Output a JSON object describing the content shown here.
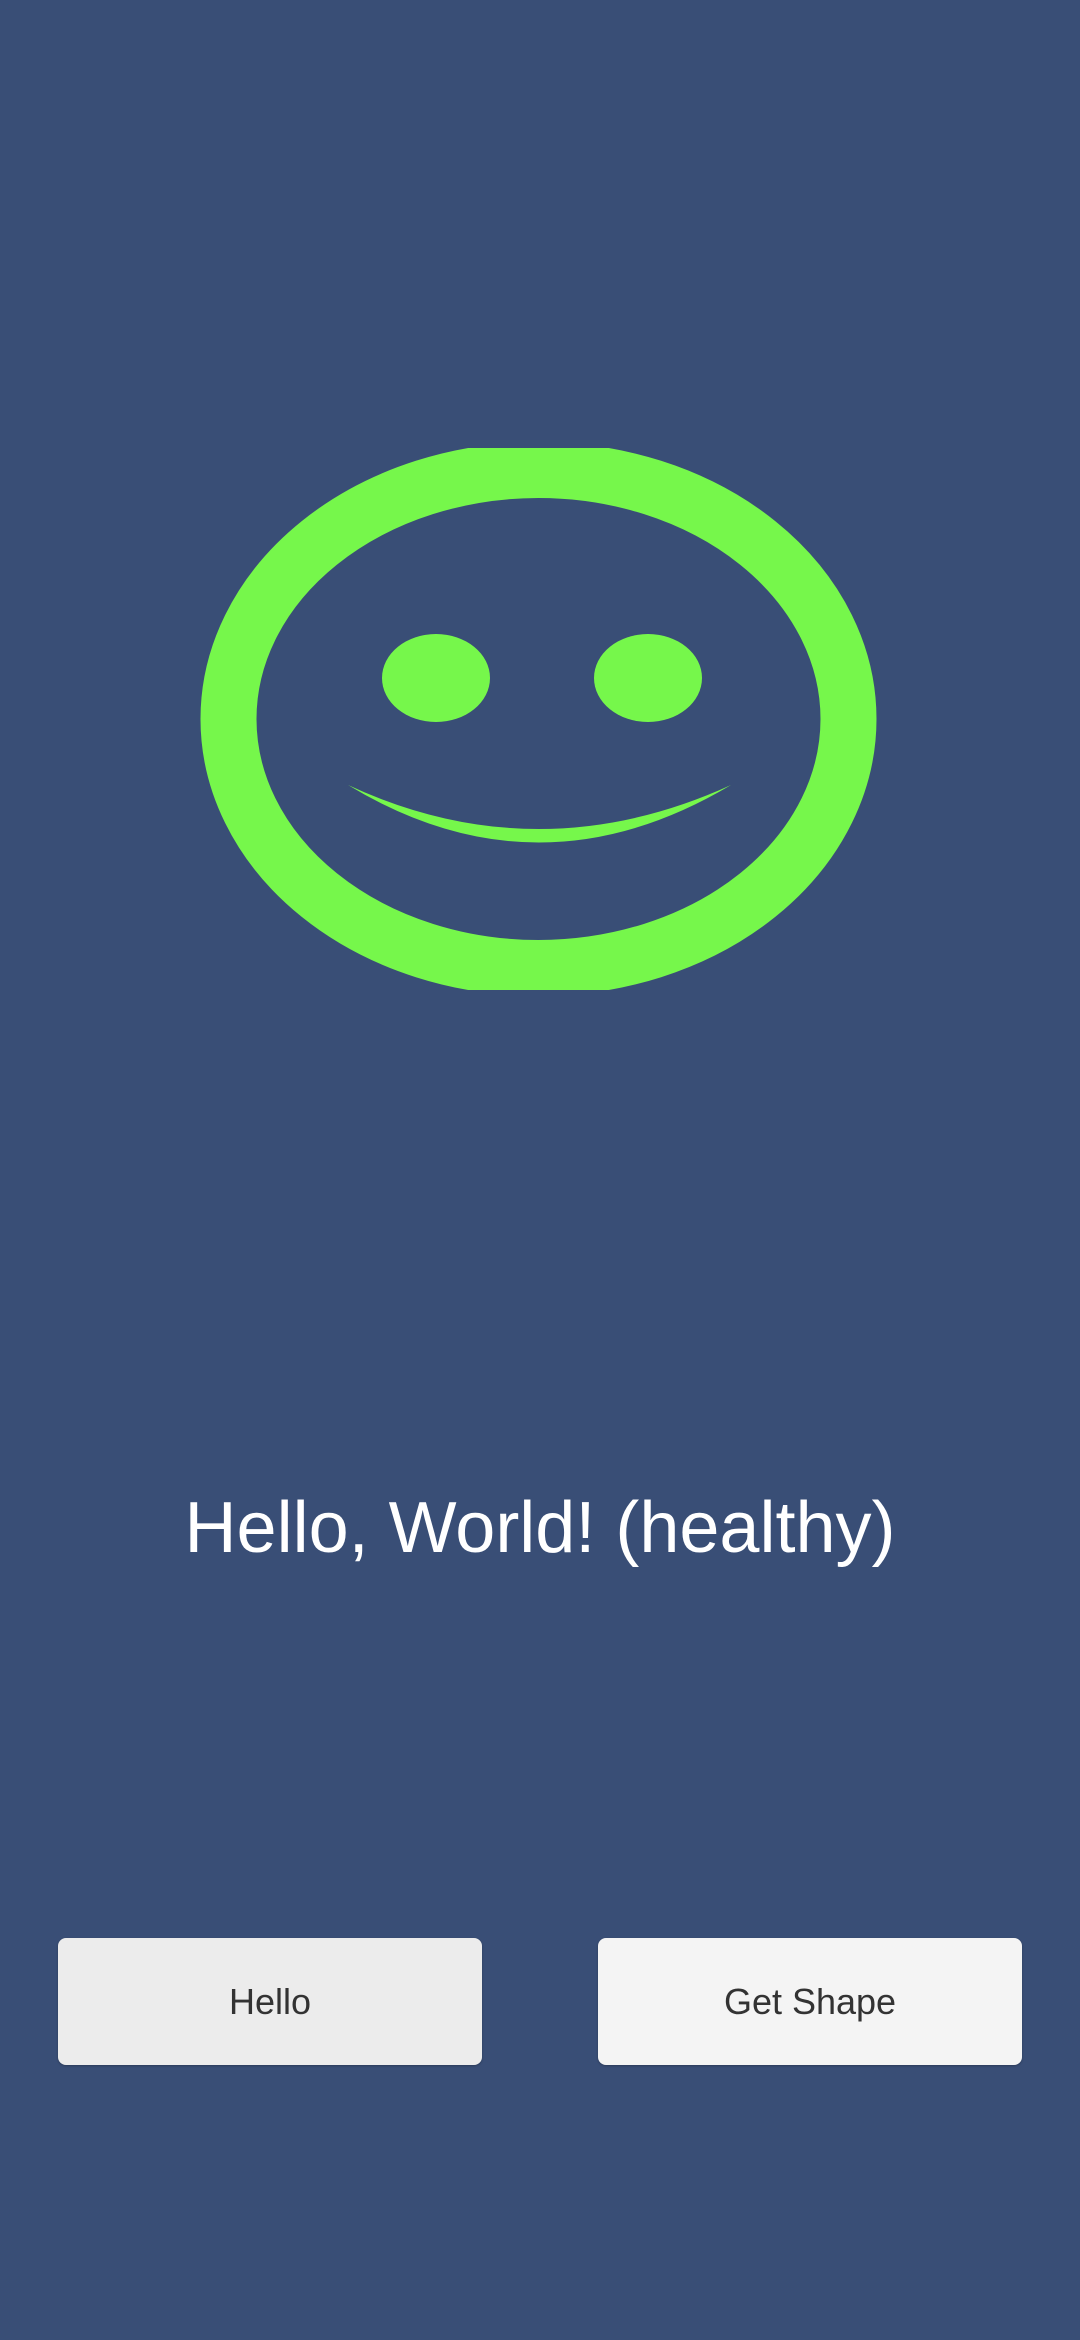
{
  "colors": {
    "background": "#394e76",
    "smiley": "#76f74b",
    "text": "#ffffff",
    "hello_button": "#ececec",
    "shape_button": "#f4f4f4"
  },
  "image": {
    "icon": "smiley-face-icon"
  },
  "greeting": "Hello, World! (healthy)",
  "buttons": {
    "hello_label": "Hello",
    "get_shape_label": "Get Shape"
  }
}
